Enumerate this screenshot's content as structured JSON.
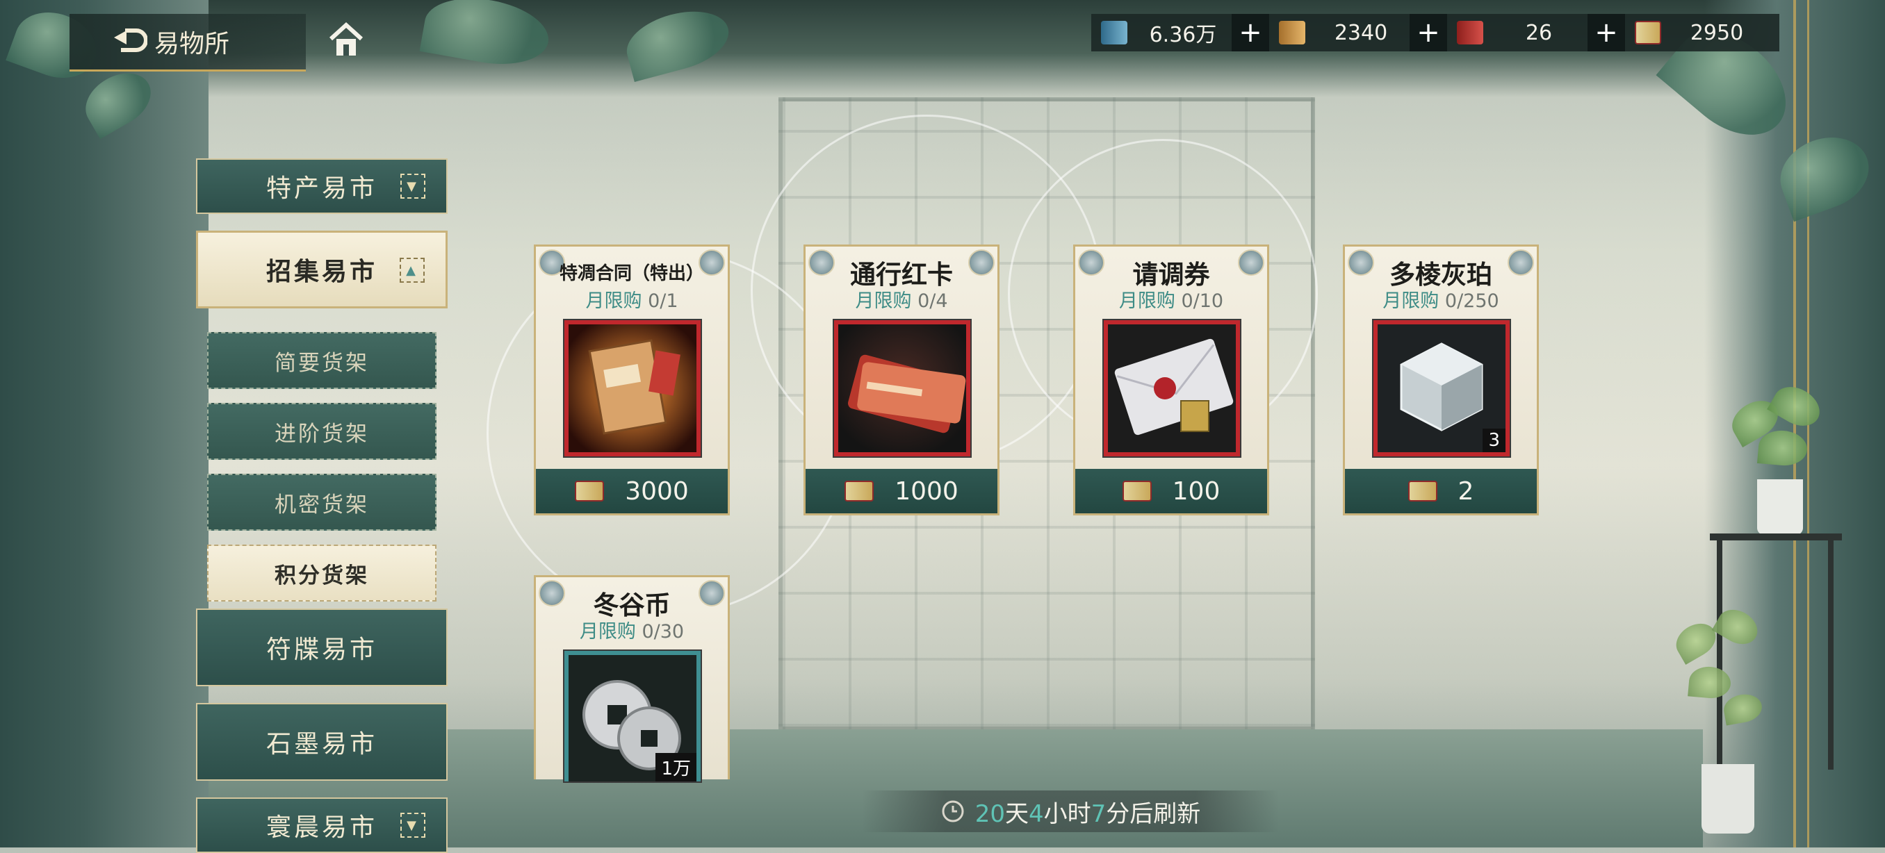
{
  "header": {
    "title": "易物所"
  },
  "currencies": [
    {
      "icon": "blue-scroll-icon",
      "color": "#4f93b5",
      "value": "6.36万",
      "has_plus": true
    },
    {
      "icon": "gold-scroll-icon",
      "color": "#d6a35a",
      "value": "2340",
      "has_plus": true
    },
    {
      "icon": "red-card-icon",
      "color": "#c23a35",
      "value": "26",
      "has_plus": true
    },
    {
      "icon": "ticket-icon",
      "color": "#e2d39a",
      "value": "2950",
      "has_plus": false
    }
  ],
  "sidebar": {
    "markets": [
      {
        "label": "特产易市",
        "active": false
      },
      {
        "label": "招集易市",
        "active": true
      },
      {
        "label": "符牒易市",
        "active": false
      },
      {
        "label": "石墨易市",
        "active": false
      },
      {
        "label": "寰晨易市",
        "active": false
      }
    ],
    "shelves": [
      {
        "label": "简要货架",
        "active": false
      },
      {
        "label": "进阶货架",
        "active": false
      },
      {
        "label": "机密货架",
        "active": false
      },
      {
        "label": "积分货架",
        "active": true
      }
    ]
  },
  "shop": {
    "limit_prefix": "月限购",
    "items": [
      {
        "name": "特凋合同（特出）",
        "limit": "0/1",
        "price": "3000",
        "item_icon": "contract-folder-icon",
        "frame_color": "#c0282d"
      },
      {
        "name": "通行红卡",
        "limit": "0/4",
        "price": "1000",
        "item_icon": "red-pass-card-icon",
        "frame_color": "#c0282d"
      },
      {
        "name": "请调券",
        "limit": "0/10",
        "price": "100",
        "item_icon": "sealed-envelope-icon",
        "frame_color": "#c0282d"
      },
      {
        "name": "多棱灰珀",
        "limit": "0/250",
        "price": "2",
        "item_icon": "crystal-cube-icon",
        "frame_color": "#c0282d",
        "quantity": "3"
      },
      {
        "name": "冬谷币",
        "limit": "0/30",
        "price": "",
        "item_icon": "coins-icon",
        "frame_color": "#3f8f92",
        "quantity": "1万"
      }
    ]
  },
  "refresh": {
    "days": "20",
    "days_unit": "天",
    "hours": "4",
    "hours_unit": "小时",
    "minutes": "7",
    "minutes_unit": "分后刷新"
  }
}
